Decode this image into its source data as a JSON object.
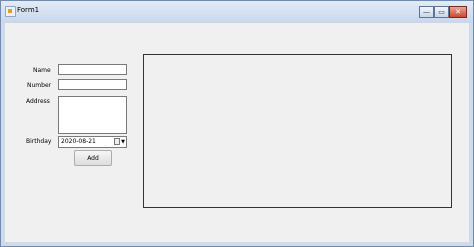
{
  "window": {
    "title": "Form1",
    "minimize_glyph": "—",
    "maximize_glyph": "▭",
    "close_glyph": "✕"
  },
  "form": {
    "name_label": "Name",
    "number_label": "Number",
    "address_label": "Address",
    "birthday_label": "Birthday",
    "name_value": "",
    "number_value": "",
    "address_value": "",
    "birthday_value": "2020-08-21",
    "add_button_label": "Add"
  },
  "icons": {
    "app": "form-app-icon",
    "calendar": "calendar-icon",
    "dropdown": "chevron-down-icon"
  }
}
